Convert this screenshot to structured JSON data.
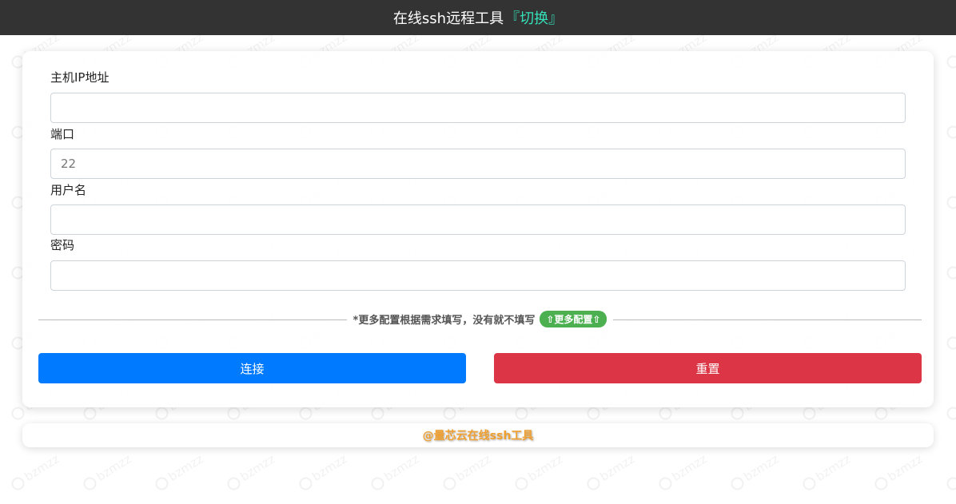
{
  "header": {
    "title": "在线ssh远程工具",
    "switch_label": "『切换』"
  },
  "watermark_text": "bzmzz",
  "form": {
    "host": {
      "label": "主机IP地址",
      "value": "",
      "placeholder": ""
    },
    "port": {
      "label": "端口",
      "value": "",
      "placeholder": "22"
    },
    "username": {
      "label": "用户名",
      "value": "",
      "placeholder": ""
    },
    "password": {
      "label": "密码",
      "value": "",
      "placeholder": ""
    }
  },
  "more_config": {
    "hint": "*更多配置根据需求填写，没有就不填写",
    "button_label": "⇧更多配置⇧"
  },
  "actions": {
    "connect_label": "连接",
    "reset_label": "重置"
  },
  "footer": {
    "text": "@量芯云在线ssh工具"
  },
  "colors": {
    "topbar": "#333333",
    "switch": "#34e0b8",
    "connect": "#007bff",
    "reset": "#dc3545",
    "more_button": "#4caf50",
    "footer_text": "#f0a030"
  }
}
